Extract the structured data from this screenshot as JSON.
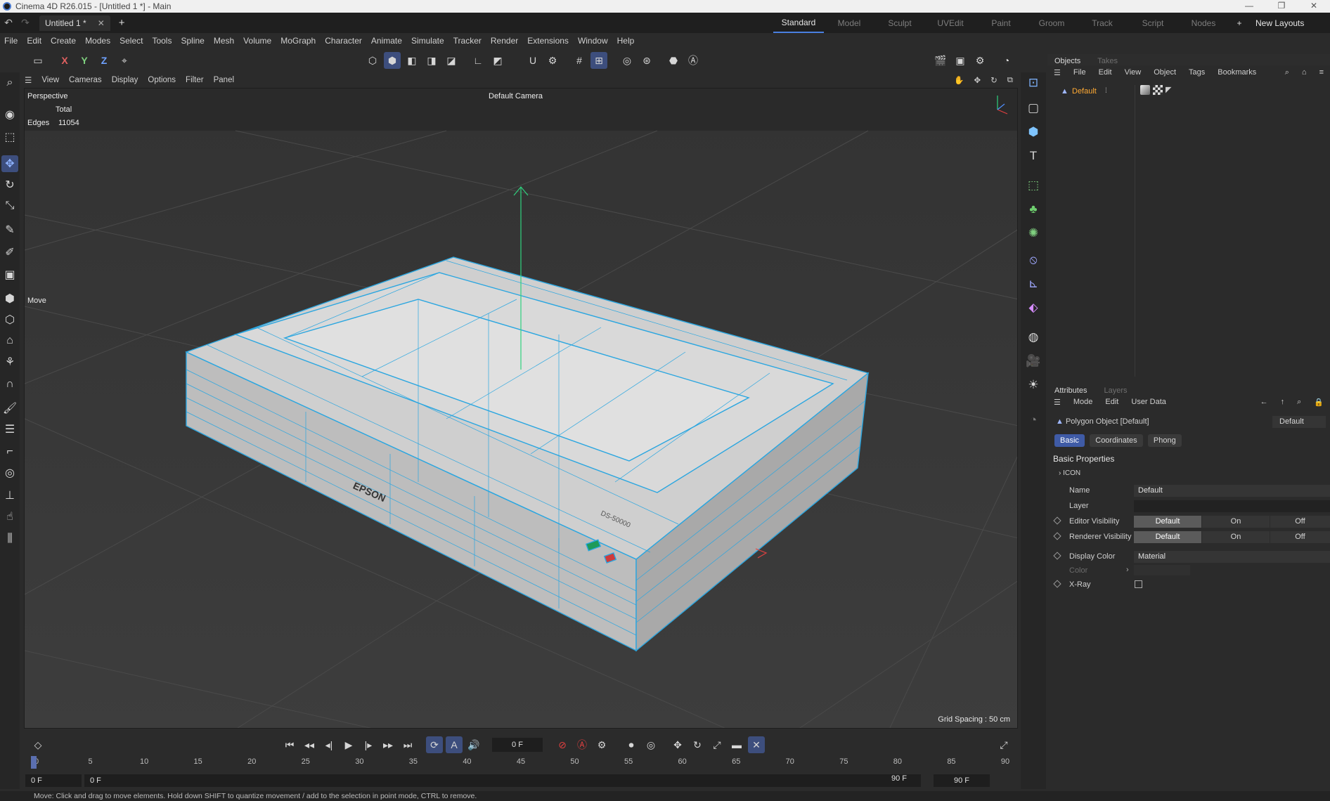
{
  "window": {
    "title": "Cinema 4D R26.015 - [Untitled 1 *] - Main",
    "controls": [
      "—",
      "❐",
      "✕"
    ]
  },
  "tabbar": {
    "doc_tab": "Untitled 1 *",
    "layouts": [
      "Standard",
      "Model",
      "Sculpt",
      "UVEdit",
      "Paint",
      "Groom",
      "Track",
      "Script",
      "Nodes"
    ],
    "active_layout": "Standard",
    "new_layouts": "New Layouts"
  },
  "menu": [
    "File",
    "Edit",
    "Create",
    "Modes",
    "Select",
    "Tools",
    "Spline",
    "Mesh",
    "Volume",
    "MoGraph",
    "Character",
    "Animate",
    "Simulate",
    "Tracker",
    "Render",
    "Extensions",
    "Window",
    "Help"
  ],
  "axis_buttons": {
    "x": "X",
    "y": "Y",
    "z": "Z"
  },
  "viewport": {
    "menu": [
      "View",
      "Cameras",
      "Display",
      "Options",
      "Filter",
      "Panel"
    ],
    "name": "Perspective",
    "camera": "Default Camera",
    "hud_total": "Total",
    "hud_edges_label": "Edges",
    "hud_edges_value": "11054",
    "tool_label": "Move",
    "grid_spacing": "Grid Spacing : 50 cm",
    "model_brand": "EPSON",
    "model_label": "DS-50000"
  },
  "objects_panel": {
    "tabs": [
      "Objects",
      "Takes"
    ],
    "menu": [
      "File",
      "Edit",
      "View",
      "Object",
      "Tags",
      "Bookmarks"
    ],
    "object_name": "Default"
  },
  "attributes_panel": {
    "tabs": [
      "Attributes",
      "Layers"
    ],
    "menu": [
      "Mode",
      "Edit",
      "User Data"
    ],
    "object_title": "Polygon Object [Default]",
    "preset": "Default",
    "subtabs": [
      "Basic",
      "Coordinates",
      "Phong"
    ],
    "section": "Basic Properties",
    "group": "ICON",
    "name_label": "Name",
    "name_value": "Default",
    "layer_label": "Layer",
    "editor_vis_label": "Editor Visibility",
    "render_vis_label": "Renderer Visibility",
    "vis_options": [
      "Default",
      "On",
      "Off"
    ],
    "display_color_label": "Display Color",
    "display_color_value": "Material",
    "color_label": "Color",
    "xray_label": "X-Ray"
  },
  "timeline": {
    "current_frame": "0 F",
    "ruler": [
      "0",
      "5",
      "10",
      "15",
      "20",
      "25",
      "30",
      "35",
      "40",
      "45",
      "50",
      "55",
      "60",
      "65",
      "70",
      "75",
      "80",
      "85",
      "90"
    ],
    "range_start": "0 F",
    "range_start2": "0 F",
    "range_end": "90 F",
    "range_end2": "90 F"
  },
  "status": "Move: Click and drag to move elements. Hold down SHIFT to quantize movement / add to the selection in point mode, CTRL to remove.",
  "colors": {
    "accent": "#3f5ba6",
    "wire": "#2aa6e0",
    "object": "#ffaa33"
  }
}
